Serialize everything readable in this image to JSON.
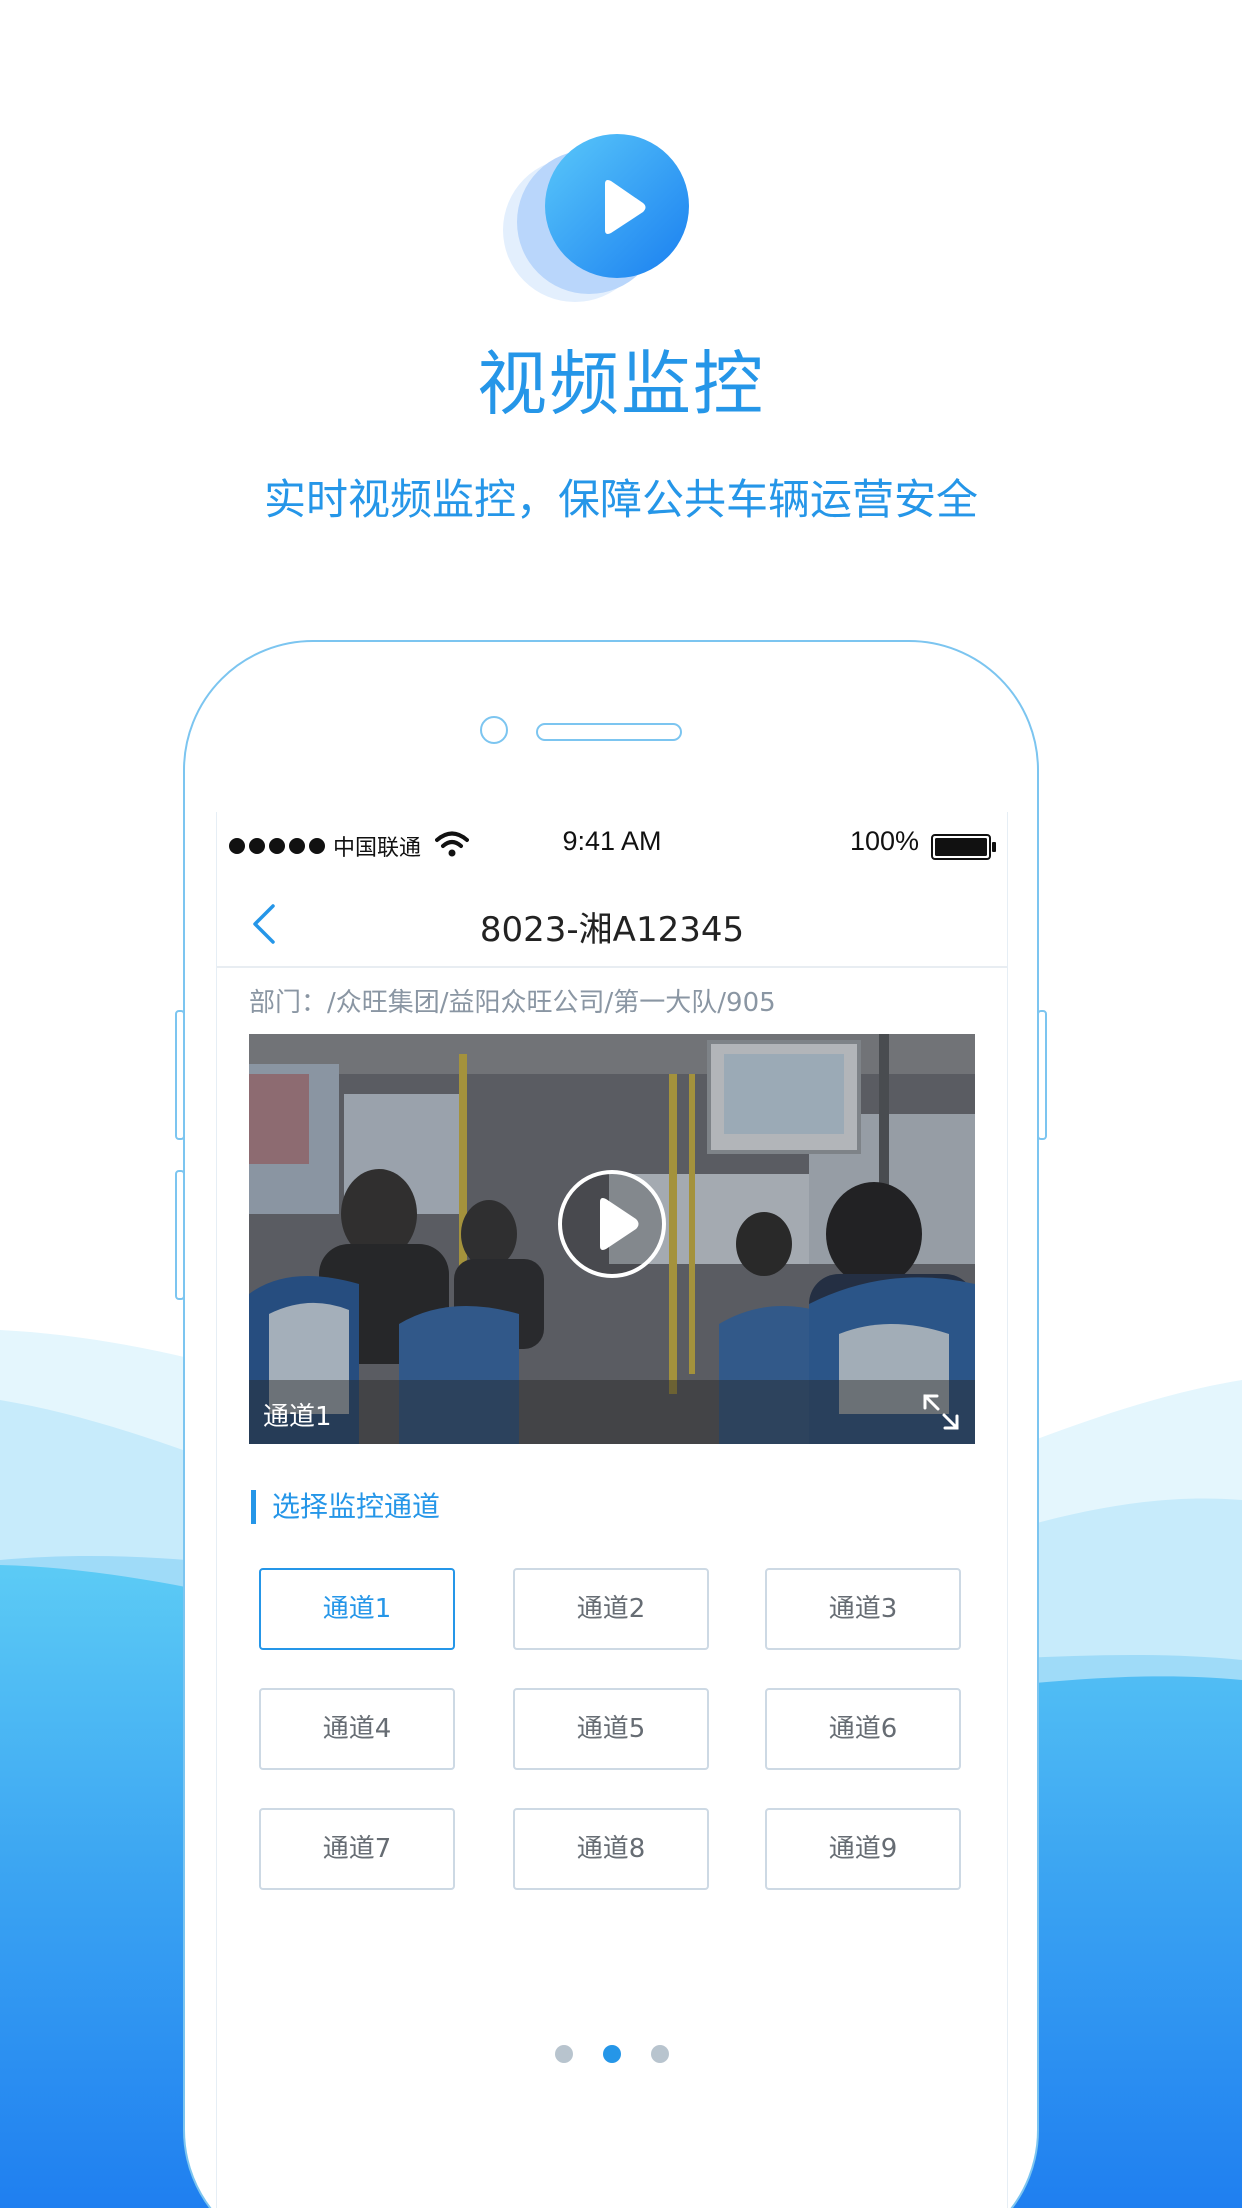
{
  "hero": {
    "title": "视频监控",
    "subtitle": "实时视频监控，保障公共车辆运营安全",
    "icon": "play-icon"
  },
  "status_bar": {
    "carrier": "中国联通",
    "time": "9:41 AM",
    "battery": "100%"
  },
  "nav": {
    "title": "8023-湘A12345",
    "back_icon": "chevron-left-icon"
  },
  "department": "部门：/众旺集团/益阳众旺公司/第一大队/905",
  "video": {
    "channel_label": "通道1",
    "play_icon": "play-circle-icon",
    "fullscreen_icon": "expand-icon"
  },
  "channel_section": {
    "title": "选择监控通道",
    "channels": [
      "通道1",
      "通道2",
      "通道3",
      "通道4",
      "通道5",
      "通道6",
      "通道7",
      "通道8",
      "通道9"
    ],
    "selected": "通道1"
  },
  "pager": {
    "total": 3,
    "active_index": 1
  },
  "colors": {
    "accent": "#2596e8",
    "phone_outline": "#7cc5f0",
    "wave_light": "#cdeefb",
    "wave_dark": "#1e86f0"
  }
}
